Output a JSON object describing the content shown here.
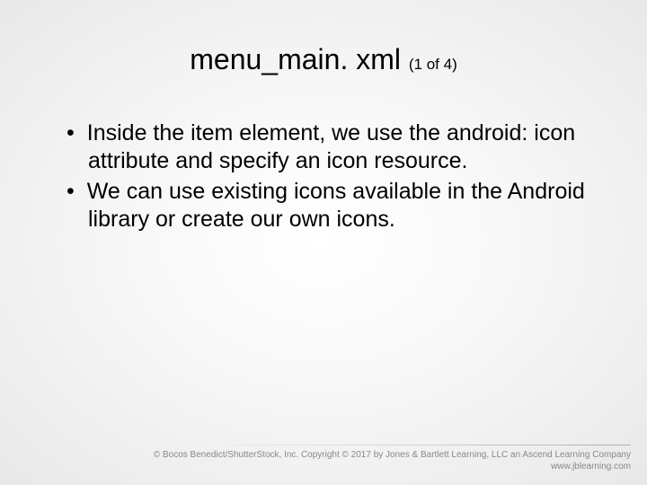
{
  "title": {
    "main": "menu_main. xml",
    "sub": "(1 of 4)"
  },
  "bullets": [
    "Inside the item element, we use the android: icon attribute and specify an icon resource.",
    "We can use existing icons available in the Android library or create our own icons."
  ],
  "footer": {
    "line1": "© Bocos Benedict/ShutterStock, Inc. Copyright © 2017 by Jones & Bartlett Learning, LLC an Ascend Learning Company",
    "line2": "www.jblearning.com"
  }
}
